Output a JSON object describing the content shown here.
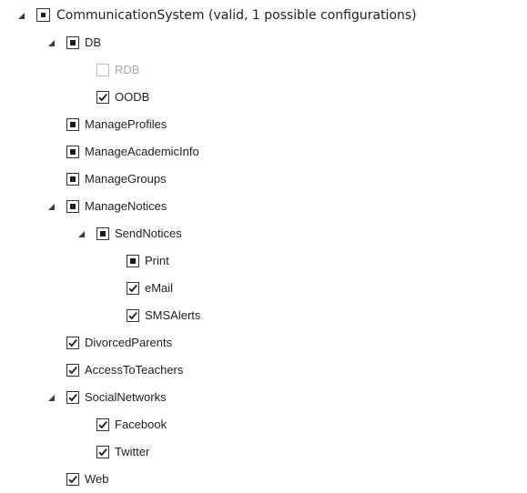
{
  "feature_tree": {
    "items": [
      {
        "label": "CommunicationSystem (valid, 1 possible configurations)",
        "level": 0,
        "expanded": true,
        "state": "indeterminate",
        "root": true
      },
      {
        "label": "DB",
        "level": 1,
        "expanded": true,
        "state": "indeterminate"
      },
      {
        "label": "RDB",
        "level": 2,
        "state": "unchecked",
        "disabled": true
      },
      {
        "label": "OODB",
        "level": 2,
        "state": "checked"
      },
      {
        "label": "ManageProfiles",
        "level": 1,
        "state": "indeterminate"
      },
      {
        "label": "ManageAcademicInfo",
        "level": 1,
        "state": "indeterminate"
      },
      {
        "label": "ManageGroups",
        "level": 1,
        "state": "indeterminate"
      },
      {
        "label": "ManageNotices",
        "level": 1,
        "expanded": true,
        "state": "indeterminate"
      },
      {
        "label": "SendNotices",
        "level": 2,
        "expanded": true,
        "state": "indeterminate"
      },
      {
        "label": "Print",
        "level": 3,
        "state": "indeterminate"
      },
      {
        "label": "eMail",
        "level": 3,
        "state": "checked"
      },
      {
        "label": "SMSAlerts",
        "level": 3,
        "state": "checked"
      },
      {
        "label": "DivorcedParents",
        "level": 1,
        "state": "checked"
      },
      {
        "label": "AccessToTeachers",
        "level": 1,
        "state": "checked"
      },
      {
        "label": "SocialNetworks",
        "level": 1,
        "expanded": true,
        "state": "checked"
      },
      {
        "label": "Facebook",
        "level": 2,
        "state": "checked"
      },
      {
        "label": "Twitter",
        "level": 2,
        "state": "checked"
      },
      {
        "label": "Web",
        "level": 1,
        "state": "checked"
      }
    ]
  }
}
